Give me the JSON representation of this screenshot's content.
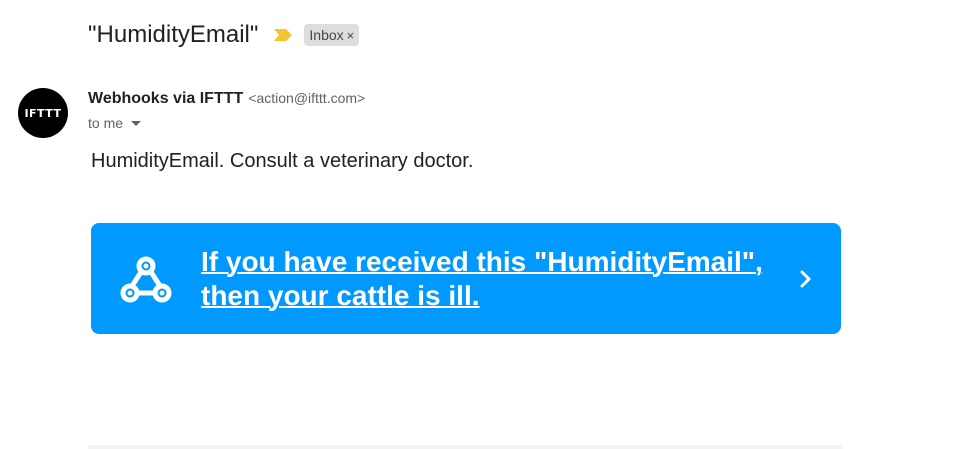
{
  "email": {
    "subject": "\"HumidityEmail\"",
    "label": "Inbox",
    "label_close": "×",
    "sender": {
      "avatar_text": "IFTTT",
      "name": "Webhooks via IFTTT",
      "email": "<action@ifttt.com>"
    },
    "recipient": "to me",
    "body_text": "HumidityEmail. Consult a veterinary doctor.",
    "action_card": {
      "link_text": "If you have received this \"HumidityEmail\", then your cattle is ill.",
      "background_color": "#0099ff",
      "icon": "webhooks-icon"
    }
  },
  "colors": {
    "importance_marker": "#f4c430",
    "label_chip_bg": "#dddddd",
    "avatar_bg": "#000000"
  }
}
